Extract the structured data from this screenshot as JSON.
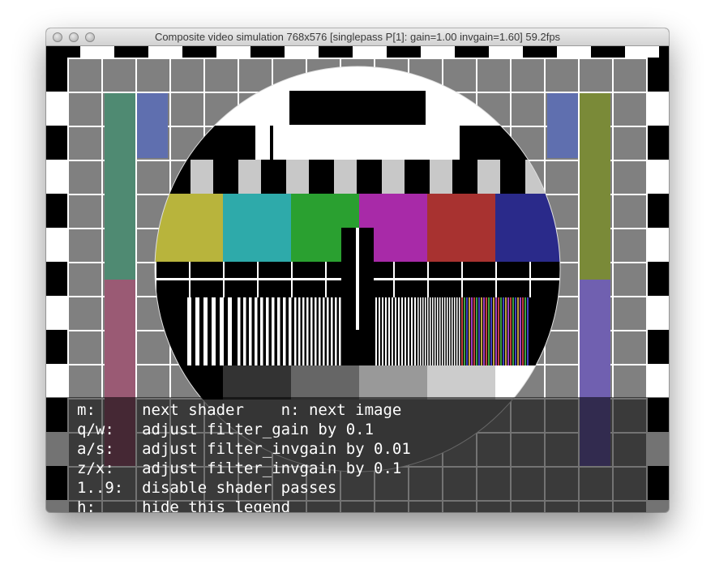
{
  "window": {
    "title": "Composite video simulation 768x576 [singlepass P[1]: gain=1.00 invgain=1.60] 59.2fps",
    "buttons": [
      "close",
      "minimize",
      "zoom"
    ]
  },
  "legend": {
    "lines": [
      "m:     next shader    n: next image",
      "q/w:   adjust filter_gain by 0.1",
      "a/s:   adjust filter_invgain by 0.01",
      "z/x:   adjust filter_invgain by 0.1",
      "1..9:  disable shader passes",
      "h:     hide this legend"
    ]
  },
  "test_card": {
    "color_bars": [
      "#b8b43c",
      "#2eaaaa",
      "#2aa030",
      "#a82aa8",
      "#a83230",
      "#2a2a8a"
    ],
    "gray_steps": [
      "#000000",
      "#333333",
      "#666666",
      "#999999",
      "#cccccc",
      "#ffffff"
    ],
    "side_bars_left": [
      "#4f8a72",
      "#5f6faf",
      "#9a5a74"
    ],
    "side_bars_right": [
      "#5f6faf",
      "#7a8a38",
      "#7060b0"
    ]
  }
}
